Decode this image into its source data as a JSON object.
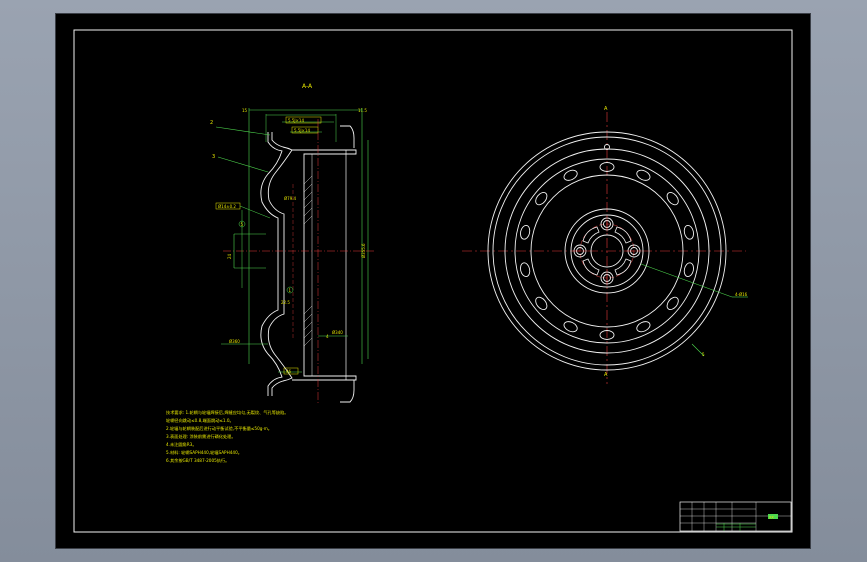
{
  "section_view": {
    "title": "A-A"
  },
  "dim_labels": {
    "top_right": "11.5",
    "top_left": "15",
    "width_outer": "5.5J×14",
    "width_inner": "5.5J×14",
    "left_tol": "Ø14±0.2",
    "center_ref": "Ø79.4",
    "diameter_right": "Ø355.6",
    "offset_left": "24",
    "bottom_dim": "46",
    "bottom_left": "Ø360",
    "mid_lower": "22.5",
    "bottom_center": "Ø340",
    "bottom_small": "4"
  },
  "callouts": {
    "c1": "1",
    "c2": "2",
    "c3": "3",
    "c4": "4",
    "c5": "5"
  },
  "front_view": {
    "top_label": "A",
    "bottom_label": "A",
    "leader_label": "4-Ø16",
    "right_label": "5"
  },
  "notes": [
    "技术要求: 1.轮辋与轮辐焊接后,焊缝应均匀,无裂纹、气孔等缺陷。",
    "轮辋径向跳动≤0.8,端面跳动≤1.0。",
    "2.轮辐与轮辋装配后进行动平衡试验,不平衡量≤50g·m。",
    "3.表面处理: 涂装前需进行磷化处理。",
    "4.未注圆角R3。",
    "5.材料: 轮辋SAPH440,轮辐SAPH440。",
    "6.其余按GB/T 3487-2005执行。"
  ],
  "title_block": {
    "stamp": "XX"
  }
}
